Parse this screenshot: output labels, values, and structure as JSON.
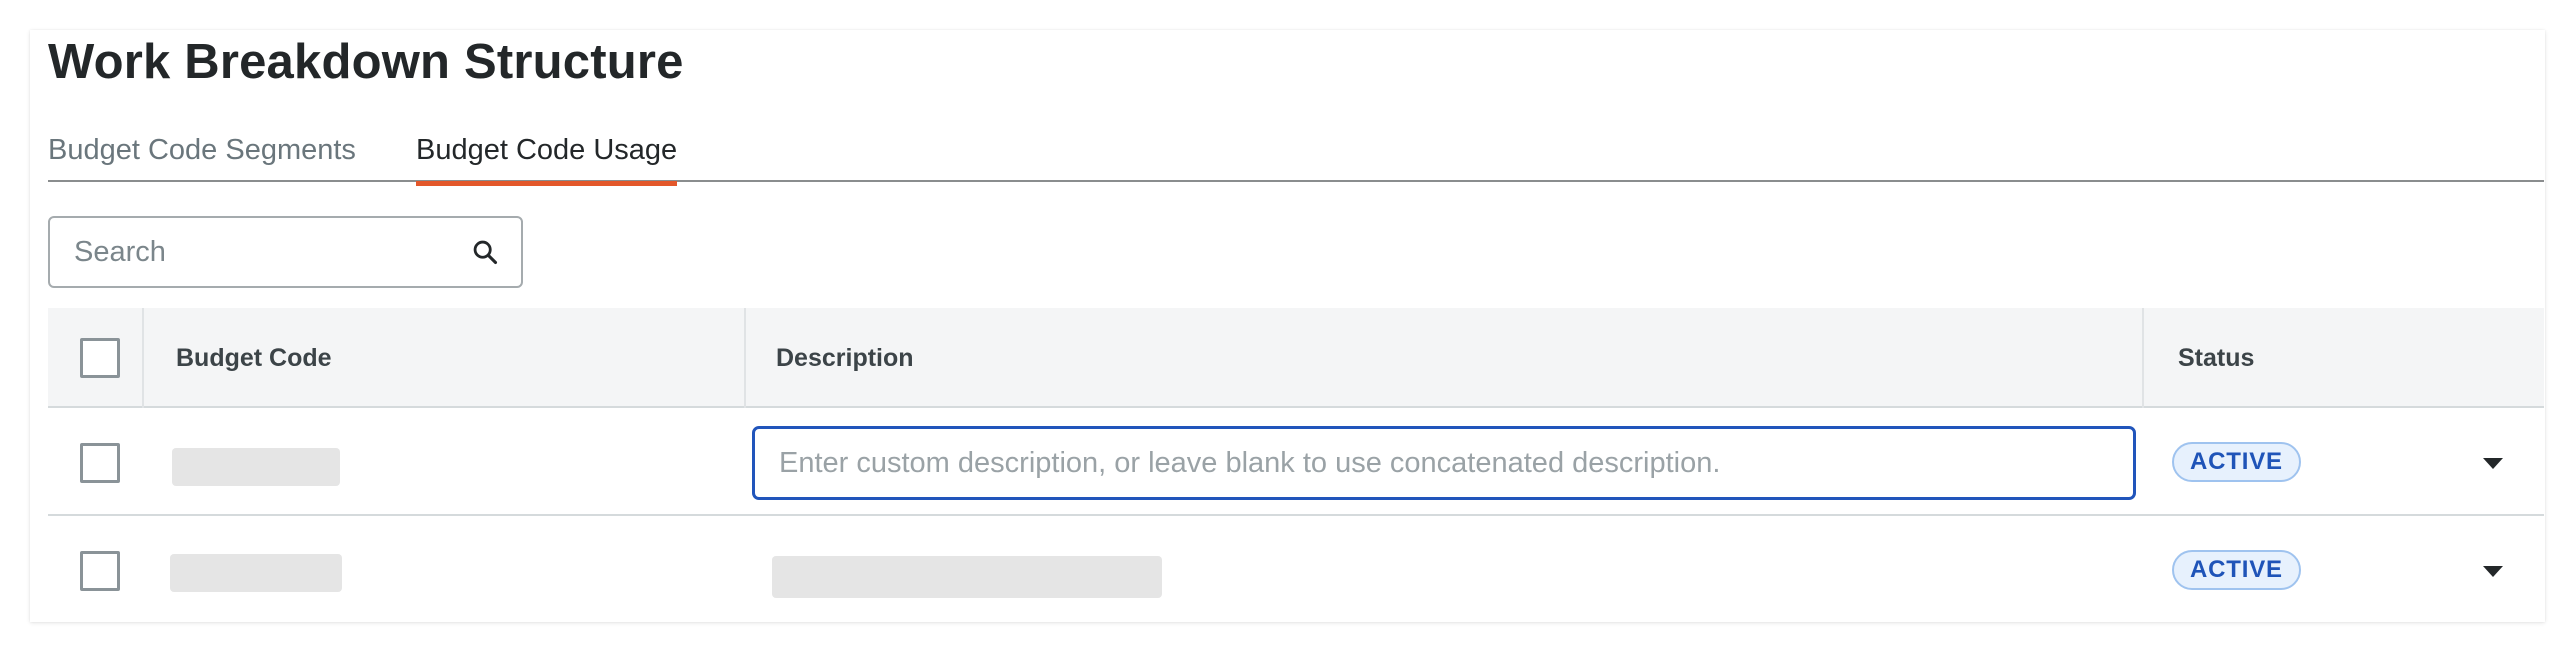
{
  "page": {
    "title": "Work Breakdown Structure"
  },
  "tabs": [
    {
      "label": "Budget Code Segments",
      "active": false
    },
    {
      "label": "Budget Code Usage",
      "active": true
    }
  ],
  "search": {
    "placeholder": "Search",
    "value": "",
    "icon": "search-icon"
  },
  "table": {
    "columns": [
      "Budget Code",
      "Description",
      "Status"
    ],
    "rows": [
      {
        "budget_code": "",
        "description_placeholder": "Enter custom description, or leave blank to use concatenated description.",
        "description_value": "",
        "status": "ACTIVE",
        "row_action_icon": "caret-down-icon"
      },
      {
        "budget_code": "",
        "description": "",
        "status": "ACTIVE",
        "row_action_icon": "caret-down-icon"
      }
    ]
  },
  "colors": {
    "tab_active_underline": "#e3572a",
    "focus_border": "#2155bb",
    "badge_bg": "#e7f1fd",
    "badge_text": "#1f54b8",
    "header_bg": "#f4f5f6"
  }
}
